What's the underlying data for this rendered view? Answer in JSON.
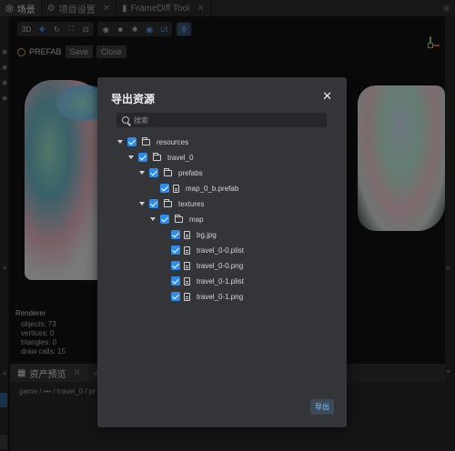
{
  "tabs": [
    {
      "label": "场景",
      "active": true
    },
    {
      "label": "项目设置",
      "active": false
    },
    {
      "label": "FrameDiff Tool",
      "active": false
    }
  ],
  "toolbar": {
    "mode_3d": "3D",
    "ui_label": "UI"
  },
  "prefab_bar": {
    "label": "PREFAB",
    "save": "Save",
    "close": "Close"
  },
  "renderer": {
    "title": "Renderer",
    "objects": "objects:  73",
    "vertices": "vertices:  0",
    "triangles": "triangles:  0",
    "draw_calls": "draw calls:  15"
  },
  "bottom_panel": {
    "tab_label": "资产预览",
    "path": "game / ••• / travel_0 / pr"
  },
  "dialog": {
    "title": "导出资源",
    "search_placeholder": "搜索",
    "export_button": "导出",
    "tree": [
      {
        "label": "resources",
        "type": "folder",
        "depth": 0,
        "expanded": true,
        "checked": true
      },
      {
        "label": "travel_0",
        "type": "folder",
        "depth": 1,
        "expanded": true,
        "checked": true
      },
      {
        "label": "prefabs",
        "type": "folder",
        "depth": 2,
        "expanded": true,
        "checked": true
      },
      {
        "label": "map_0_b.prefab",
        "type": "file",
        "depth": 3,
        "checked": true
      },
      {
        "label": "textures",
        "type": "folder",
        "depth": 2,
        "expanded": true,
        "checked": true
      },
      {
        "label": "map",
        "type": "folder",
        "depth": 3,
        "expanded": true,
        "checked": true
      },
      {
        "label": "bg.jpg",
        "type": "file",
        "depth": 4,
        "checked": true
      },
      {
        "label": "travel_0-0.plist",
        "type": "file",
        "depth": 4,
        "checked": true
      },
      {
        "label": "travel_0-0.png",
        "type": "file",
        "depth": 4,
        "checked": true
      },
      {
        "label": "travel_0-1.plist",
        "type": "file",
        "depth": 4,
        "checked": true
      },
      {
        "label": "travel_0-1.png",
        "type": "file",
        "depth": 4,
        "checked": true
      }
    ]
  },
  "colors": {
    "accent": "#2d8cf0",
    "dialog_bg": "#333538",
    "export_text": "#7fc6ff"
  }
}
